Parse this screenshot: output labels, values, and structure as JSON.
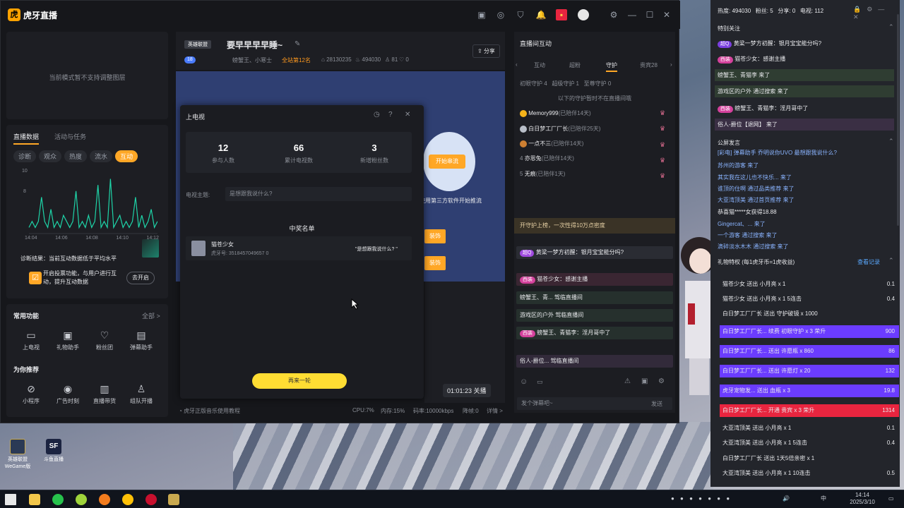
{
  "app": {
    "name": "虎牙直播",
    "title_bar_icons": [
      "box-icon",
      "game-icon",
      "shirt-icon",
      "bell-icon",
      "gift-icon",
      "avatar",
      "gear-icon",
      "minimize-icon",
      "maximize-icon",
      "close-icon"
    ]
  },
  "left": {
    "layer_notice": "当前模式暂不支持调整图层",
    "tabs": [
      "直播数据",
      "活动与任务"
    ],
    "chips": [
      "诊断",
      "观众",
      "热度",
      "流水",
      "互动"
    ],
    "active_chip": "互动",
    "chart_ymax": "10",
    "chart_ymid": "8",
    "time_labels": [
      "14:04",
      "14:06",
      "14:08",
      "14:10",
      "14:12"
    ],
    "diagnosis": "诊断结果：当前互动数据低于平均水平",
    "tip": "开启投票功能，与用户进行互动，提升互动数据",
    "tip_button": "去开启",
    "common_title": "常用功能",
    "all_label": "全部 >",
    "tools": [
      "上电视",
      "礼物助手",
      "粉丝团",
      "弹幕助手"
    ],
    "recommend_title": "为你推荐",
    "recommend": [
      "小程序",
      "广告时刻",
      "直播带货",
      "组队开播"
    ]
  },
  "stream": {
    "category": "英雄联盟",
    "title": "要早早早早睡~",
    "level_badge": "18",
    "mods": "螃蟹王、小寒士",
    "rank": "全站第12名",
    "room_id": "28130235",
    "heat": "494030",
    "fans": "81",
    "likes": "0",
    "share": "分享",
    "start_button": "开始串流",
    "third_party_hint": "使用第三方软件开始推流",
    "side_btn_1": "装饰",
    "side_btn_2": "装饰",
    "timer": "01:01:23 关播"
  },
  "dialog": {
    "title": "上电视",
    "stats": [
      {
        "value": "12",
        "label": "参与人数"
      },
      {
        "value": "66",
        "label": "累计电视数"
      },
      {
        "value": "3",
        "label": "新增粉丝数"
      }
    ],
    "topic_label": "电视主题:",
    "topic_value": "是想跟我说什么?",
    "winners_title": "中奖名单",
    "winner": {
      "name": "猫苍少女",
      "id": "虎牙号: 3518457049657 0",
      "message": "\"是想跟我说什么? \""
    },
    "action_button": "再来一轮"
  },
  "statusbar": {
    "hint": "虎牙正版音乐使用教程",
    "cpu": "CPU:7%",
    "mem": "内存:15%",
    "bitrate": "码率:10000kbps",
    "drop": "降帧:0",
    "detail": "详情 >"
  },
  "right": {
    "title": "直播间互动",
    "tabs": [
      "互动",
      "超粉",
      "守护",
      "贵宾28"
    ],
    "active_tab": "守护",
    "guard_stats": "初眼守护 4   超级守护 1   至尊守护 0",
    "offline_note": "以下的守护暂时不在直播间哦",
    "guards": [
      {
        "rank": "1",
        "name": "Memory999",
        "days": "(已陪伴14天)"
      },
      {
        "rank": "2",
        "name": "白日梦工厂厂长",
        "days": "(已陪伴25天)"
      },
      {
        "rank": "3",
        "name": "一点不三",
        "days": "(已陪伴14天)"
      },
      {
        "rank": "4",
        "name": "亦恩兔",
        "days": "(已陪伴14天)"
      },
      {
        "rank": "5",
        "name": "无痕",
        "days": "(已陪伴1天)"
      }
    ],
    "promo": "开守护上榜，一次性得10万点密度",
    "chat": [
      {
        "badge": "超Q",
        "text": "黄梁一梦方初醒：银月宝宝能分吗?"
      },
      {
        "badge": "西装",
        "text": "猫苍少女：感谢主播"
      },
      {
        "badge": "",
        "text": "螃蟹王、青... 驾临直播间"
      },
      {
        "badge": "",
        "text": "游戏区的户外 驾临直播间"
      },
      {
        "badge": "西装",
        "text": "螃蟹王、青猫李：淫月哥中了"
      },
      {
        "badge": "",
        "text": "俗人-爵位... 驾临直播间"
      }
    ],
    "input_placeholder": "发个弹幕吧~",
    "send": "发送"
  },
  "side": {
    "header": "热度: 494030   粉丝: 5   分享: 0   电视: 112",
    "special_title": "特别关注",
    "special": [
      "黄梁一梦方初醒：银月宝宝能分吗?",
      "猫苍少女：感谢主播",
      "螃蟹王、青猫李 来了",
      "游戏区的户外 通过搜索 来了",
      "螃蟹王、青猫李：淫月哥中了",
      "俗人-爵位【退网】 来了"
    ],
    "public_title": "公屏发言",
    "public": [
      "[彩电] 弹幕助手 乔明说你UVO 最想跟我说什么?",
      "苏州的游客 来了",
      "其实我在这儿也不快乐... 来了",
      "谁顶的住啊 通过品类推荐 来了",
      "大亚湾顶美 通过首页推荐 来了",
      "恭喜猫*****女获得18.88",
      "Gingercat、... 来了",
      "一个游客 通过搜索 来了",
      "滴碎淡水木木 通过搜索 来了"
    ],
    "gift_title": "礼物特权 (每1虎牙币=1虎收益)",
    "gift_link": "查看记录",
    "gifts": [
      {
        "text": "猫苍少女 送出 小月亮 x 1",
        "value": "0.1",
        "style": "plain"
      },
      {
        "text": "猫苍少女 送出 小月亮 x 1 5连击",
        "value": "0.4",
        "style": "plain"
      },
      {
        "text": "白日梦工厂厂长 送出 守护破镜 x 1000",
        "value": "",
        "style": "plain"
      },
      {
        "text": "白日梦工厂厂长... 续费 初眼守护 x 3 荣升",
        "value": "900",
        "style": "purple"
      },
      {
        "text": "白日梦工厂厂长... 送出 许愿瓶 x 860",
        "value": "86",
        "style": "purple"
      },
      {
        "text": "白日梦工厂厂长... 送出 许愿灯 x 20",
        "value": "132",
        "style": "purple"
      },
      {
        "text": "虎牙宠物发... 送出 血瓶 x 3",
        "value": "19.8",
        "style": "purple"
      },
      {
        "text": "白日梦工厂厂长... 开通 贵宾 x 3 荣升",
        "value": "1314",
        "style": "red"
      },
      {
        "text": "大亚湾顶美 送出 小月亮 x 1",
        "value": "0.1",
        "style": "plain"
      },
      {
        "text": "大亚湾顶美 送出 小月亮 x 1 5连击",
        "value": "0.4",
        "style": "plain"
      },
      {
        "text": "白日梦工厂厂长 送出 1天5倍亲密 x 1",
        "value": "",
        "style": "plain"
      },
      {
        "text": "大亚湾顶美 送出 小月亮 x 1 10连击",
        "value": "0.5",
        "style": "plain"
      }
    ]
  },
  "desktop": {
    "icons": [
      "英雄联盟WeGame版",
      "斗鱼直播"
    ],
    "clock_time": "14:14",
    "clock_date": "2025/3/10",
    "ime": "中"
  },
  "colors": {
    "accent": "#ffa726",
    "purple": "#6b3cff",
    "red": "#e8253f",
    "panel": "#1d1e23"
  }
}
